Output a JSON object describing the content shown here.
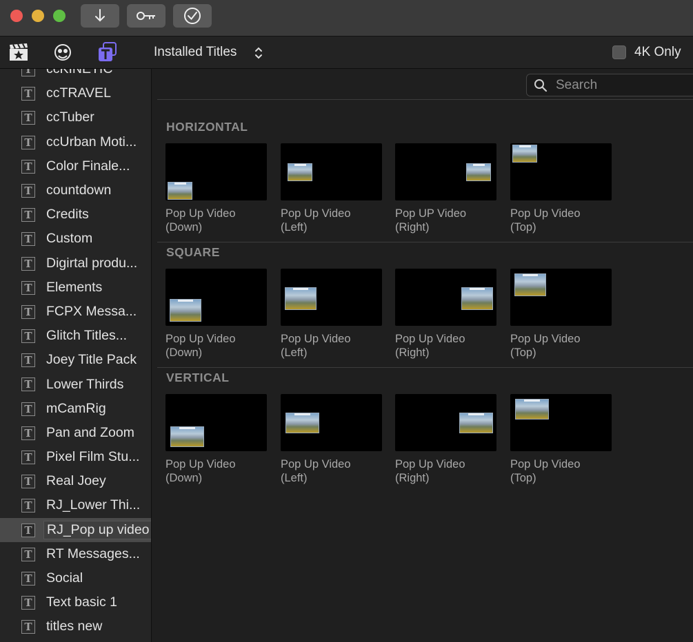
{
  "library": {
    "title": "Installed Titles",
    "four_k_label": "4K Only"
  },
  "search": {
    "placeholder": "Search"
  },
  "sidebar": {
    "items": [
      "ccKINETIC",
      "ccTRAVEL",
      "ccTuber",
      "ccUrban Moti...",
      "Color Finale...",
      "countdown",
      "Credits",
      "Custom",
      "Digirtal produ...",
      "Elements",
      "FCPX Messa...",
      "Glitch Titles...",
      "Joey Title Pack",
      "Lower Thirds",
      "mCamRig",
      "Pan and Zoom",
      "Pixel Film Stu...",
      "Real Joey",
      "RJ_Lower Thi...",
      "RJ_Pop up video",
      "RT Messages...",
      "Social",
      "Text basic 1",
      "titles new"
    ],
    "selected": "RJ_Pop up video"
  },
  "sections": [
    {
      "title": "HORIZONTAL",
      "tiles": [
        {
          "line1": "Pop Up Video",
          "line2": "(Down)"
        },
        {
          "line1": "Pop Up Video",
          "line2": "(Left)"
        },
        {
          "line1": "Pop UP Video",
          "line2": "(Right)"
        },
        {
          "line1": "Pop Up Video",
          "line2": "(Top)"
        }
      ]
    },
    {
      "title": "SQUARE",
      "tiles": [
        {
          "line1": "Pop Up Video",
          "line2": "(Down)"
        },
        {
          "line1": "Pop Up Video",
          "line2": "(Left)"
        },
        {
          "line1": "Pop Up Video",
          "line2": "(Right)"
        },
        {
          "line1": "Pop Up Video",
          "line2": "(Top)"
        }
      ]
    },
    {
      "title": "VERTICAL",
      "tiles": [
        {
          "line1": "Pop Up Video",
          "line2": "(Down)"
        },
        {
          "line1": "Pop Up Video",
          "line2": "(Left)"
        },
        {
          "line1": "Pop Up Video",
          "line2": "(Right)"
        },
        {
          "line1": "Pop Up Video",
          "line2": "(Top)"
        }
      ]
    }
  ],
  "colors": {
    "accent_purple": "#7b6cf0",
    "close": "#ee5a55",
    "minimize": "#e4b13d",
    "zoom": "#5fbf44"
  },
  "icons": {
    "import": "arrow-down-icon",
    "keywords": "key-icon",
    "analysis": "checkmark-circle-icon"
  }
}
